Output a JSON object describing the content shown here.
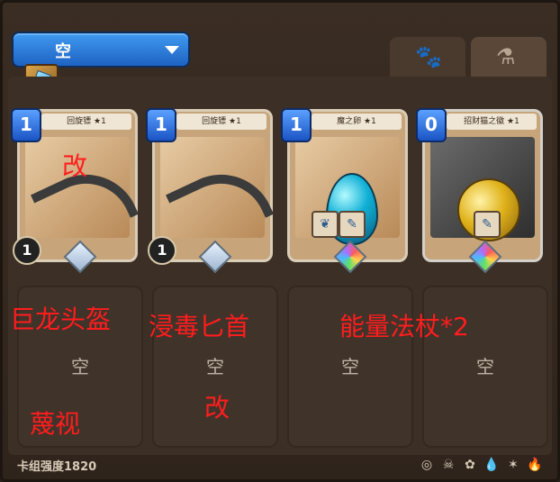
{
  "deck": {
    "name": "空"
  },
  "tabs": [
    {
      "icon": "paw-icon",
      "glyph": "🐾"
    },
    {
      "icon": "potion-flask-icon",
      "glyph": "⚗"
    }
  ],
  "cards": [
    {
      "cost": "1",
      "title": "回旋镖 ★1",
      "attack": "1",
      "gem": "crystal"
    },
    {
      "cost": "1",
      "title": "回旋镖 ★1",
      "attack": "1",
      "gem": "crystal"
    },
    {
      "cost": "1",
      "title": "魔之卵 ★1",
      "gem": "rainbow",
      "badge_count": "1"
    },
    {
      "cost": "0",
      "title": "招财猫之徽 ★1",
      "gem": "rainbow",
      "badge_count": "1"
    }
  ],
  "empty_slots": [
    {
      "label": "空"
    },
    {
      "label": "空"
    },
    {
      "label": "空"
    },
    {
      "label": "空"
    }
  ],
  "overlays": {
    "a": "改",
    "b": "巨龙头盔",
    "c": "浸毒匕首",
    "d": "能量法杖*2",
    "e": "蔑视",
    "f": "改"
  },
  "footer": {
    "power_label": "卡组强度1820"
  },
  "colors": {
    "accent_blue": "#2f7fe0",
    "overlay_red": "#ff1d1d",
    "panel_brown": "#3b2f26"
  }
}
